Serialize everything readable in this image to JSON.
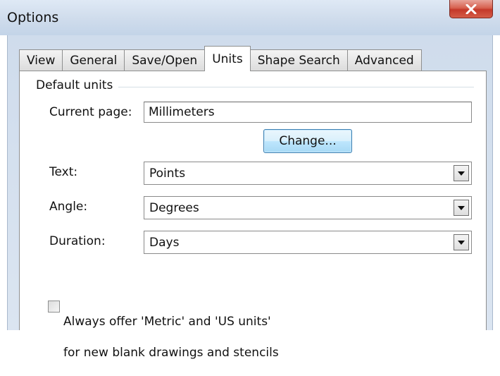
{
  "window": {
    "title": "Options",
    "close_icon": "close-x-icon"
  },
  "tabs": [
    {
      "label": "View",
      "active": false
    },
    {
      "label": "General",
      "active": false
    },
    {
      "label": "Save/Open",
      "active": false
    },
    {
      "label": "Units",
      "active": true
    },
    {
      "label": "Shape Search",
      "active": false
    },
    {
      "label": "Advanced",
      "active": false
    }
  ],
  "default_units": {
    "group_label": "Default units",
    "current_page_label": "Current page:",
    "current_page_value": "Millimeters",
    "change_button": "Change...",
    "text_label": "Text:",
    "text_value": "Points",
    "angle_label": "Angle:",
    "angle_value": "Degrees",
    "duration_label": "Duration:",
    "duration_value": "Days"
  },
  "metric_option": {
    "checked": false,
    "line1": "Always offer 'Metric' and 'US units'",
    "line2": "for new blank drawings and stencils"
  },
  "colors": {
    "title_bar": "#cfdcec",
    "close_button": "#c4392a",
    "button_focus_border": "#3c7fb1"
  }
}
